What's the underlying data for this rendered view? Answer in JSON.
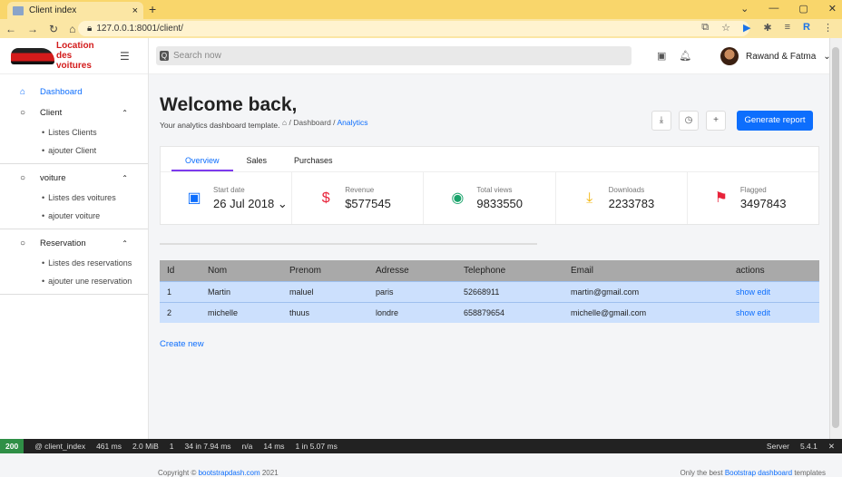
{
  "browser": {
    "tab_title": "Client index",
    "url": "127.0.0.1:8001/client/"
  },
  "brand": {
    "line1": "Location des",
    "line2": "voitures"
  },
  "sidebar": {
    "dashboard": "Dashboard",
    "groups": [
      {
        "label": "Client",
        "items": [
          "Listes Clients",
          "ajouter Client"
        ]
      },
      {
        "label": "voiture",
        "items": [
          "Listes des voitures",
          "ajouter voiture"
        ]
      },
      {
        "label": "Reservation",
        "items": [
          "Listes des reservations",
          "ajouter une reservation"
        ]
      }
    ]
  },
  "topbar": {
    "search_placeholder": "Search now",
    "user": "Rawand & Fatma"
  },
  "page": {
    "title": "Welcome back,",
    "subtitle": "Your analytics dashboard template.",
    "crumb_home": "/ Dashboard /",
    "crumb_active": "Analytics",
    "generate": "Generate report"
  },
  "tabs": [
    "Overview",
    "Sales",
    "Purchases"
  ],
  "stats": [
    {
      "label": "Start date",
      "value": "26 Jul 2018 ⌄",
      "icon": "calendar-icon",
      "color": "#0d6efd"
    },
    {
      "label": "Revenue",
      "value": "$577545",
      "icon": "dollar-icon",
      "color": "#e8233a"
    },
    {
      "label": "Total views",
      "value": "9833550",
      "icon": "eye-icon",
      "color": "#1aa36b"
    },
    {
      "label": "Downloads",
      "value": "2233783",
      "icon": "download-icon",
      "color": "#f3b50c"
    },
    {
      "label": "Flagged",
      "value": "3497843",
      "icon": "flag-icon",
      "color": "#e8233a"
    }
  ],
  "table": {
    "headers": [
      "Id",
      "Nom",
      "Prenom",
      "Adresse",
      "Telephone",
      "Email",
      "actions"
    ],
    "rows": [
      [
        "1",
        "Martin",
        "maluel",
        "paris",
        "52668911",
        "martin@gmail.com",
        "show edit"
      ],
      [
        "2",
        "michelle",
        "thuus",
        "londre",
        "658879654",
        "michelle@gmail.com",
        "show edit"
      ]
    ]
  },
  "create_new": "Create new",
  "footer": {
    "left_prefix": "Copyright © ",
    "left_link": "bootstrapdash.com",
    "left_suffix": " 2021",
    "right_prefix": "Only the best ",
    "right_link": "Bootstrap dashboard",
    "right_suffix": " templates"
  },
  "debugbar": {
    "status": "200",
    "route": "@ client_index",
    "time": "461 ms",
    "mem": "2.0 MiB",
    "layers": "1",
    "cache": "34 in 7.94 ms",
    "user": "n/a",
    "twig": "14 ms",
    "db": "1 in 5.07 ms",
    "server": "Server",
    "version": "5.4.1"
  }
}
